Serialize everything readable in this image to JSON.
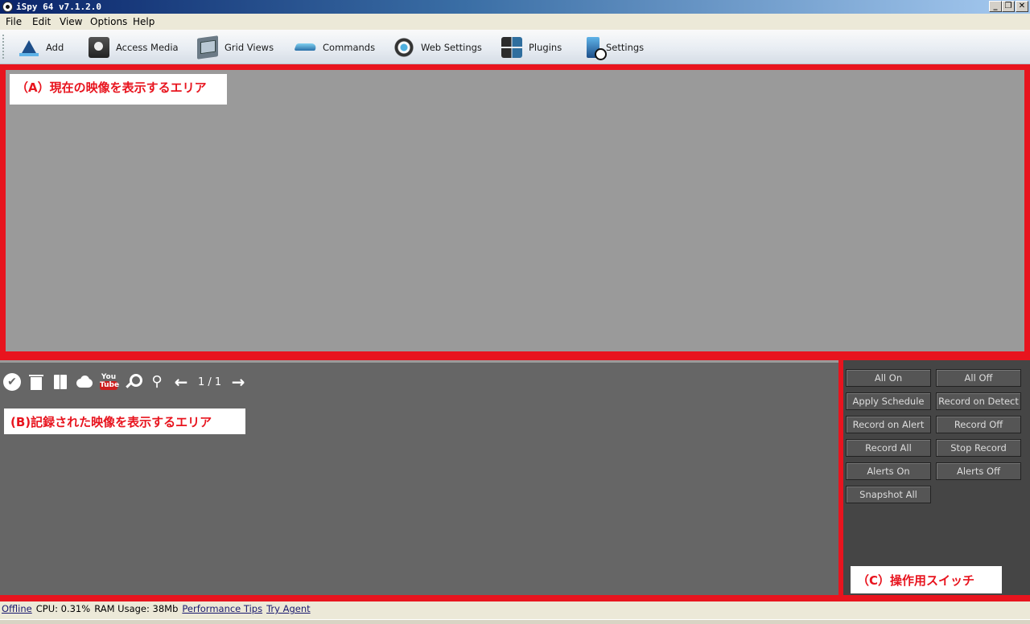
{
  "window": {
    "title": "iSpy 64 v7.1.2.0",
    "minimize_glyph": "_",
    "restore_glyph": "❐",
    "close_glyph": "✕"
  },
  "menu": [
    "File",
    "Edit",
    "View",
    "Options",
    "Help"
  ],
  "toolbar": [
    {
      "label": "Add",
      "icon": "add-icon"
    },
    {
      "label": "Access Media",
      "icon": "access-media-icon"
    },
    {
      "label": "Grid Views",
      "icon": "grid-views-icon"
    },
    {
      "label": "Commands",
      "icon": "commands-icon"
    },
    {
      "label": "Web Settings",
      "icon": "web-settings-icon"
    },
    {
      "label": "Plugins",
      "icon": "plugins-icon"
    },
    {
      "label": "Settings",
      "icon": "settings-icon"
    }
  ],
  "area_a": {
    "label": "（A）現在の映像を表示するエリア"
  },
  "area_b": {
    "label": "(B)記録された映像を表示するエリア",
    "tools": [
      "check-icon",
      "trash-icon",
      "bookmark-icon",
      "cloud-upload-icon",
      "youtube-icon",
      "search-icon",
      "tree-icon",
      "arrow-left-icon"
    ],
    "youtube_top": "You",
    "youtube_bottom": "Tube",
    "page": "1 / 1",
    "check_glyph": "✔",
    "tree_glyph": "⚲",
    "prev_glyph": "←",
    "next_glyph": "→"
  },
  "area_c": {
    "label": "（C）操作用スイッチ",
    "buttons": [
      "All On",
      "All Off",
      "Apply Schedule",
      "Record on Detect",
      "Record on Alert",
      "Record Off",
      "Record All",
      "Stop Record",
      "Alerts On",
      "Alerts Off",
      "Snapshot All"
    ]
  },
  "status": {
    "offline": "Offline",
    "cpu": "CPU: 0.31%",
    "ram": "RAM Usage: 38Mb",
    "tips": "Performance Tips",
    "agent": "Try Agent"
  },
  "colors": {
    "annotation_red": "#e8141e",
    "live_bg": "#9a9a9a",
    "recorded_bg": "#666666",
    "controls_bg": "#454545"
  }
}
